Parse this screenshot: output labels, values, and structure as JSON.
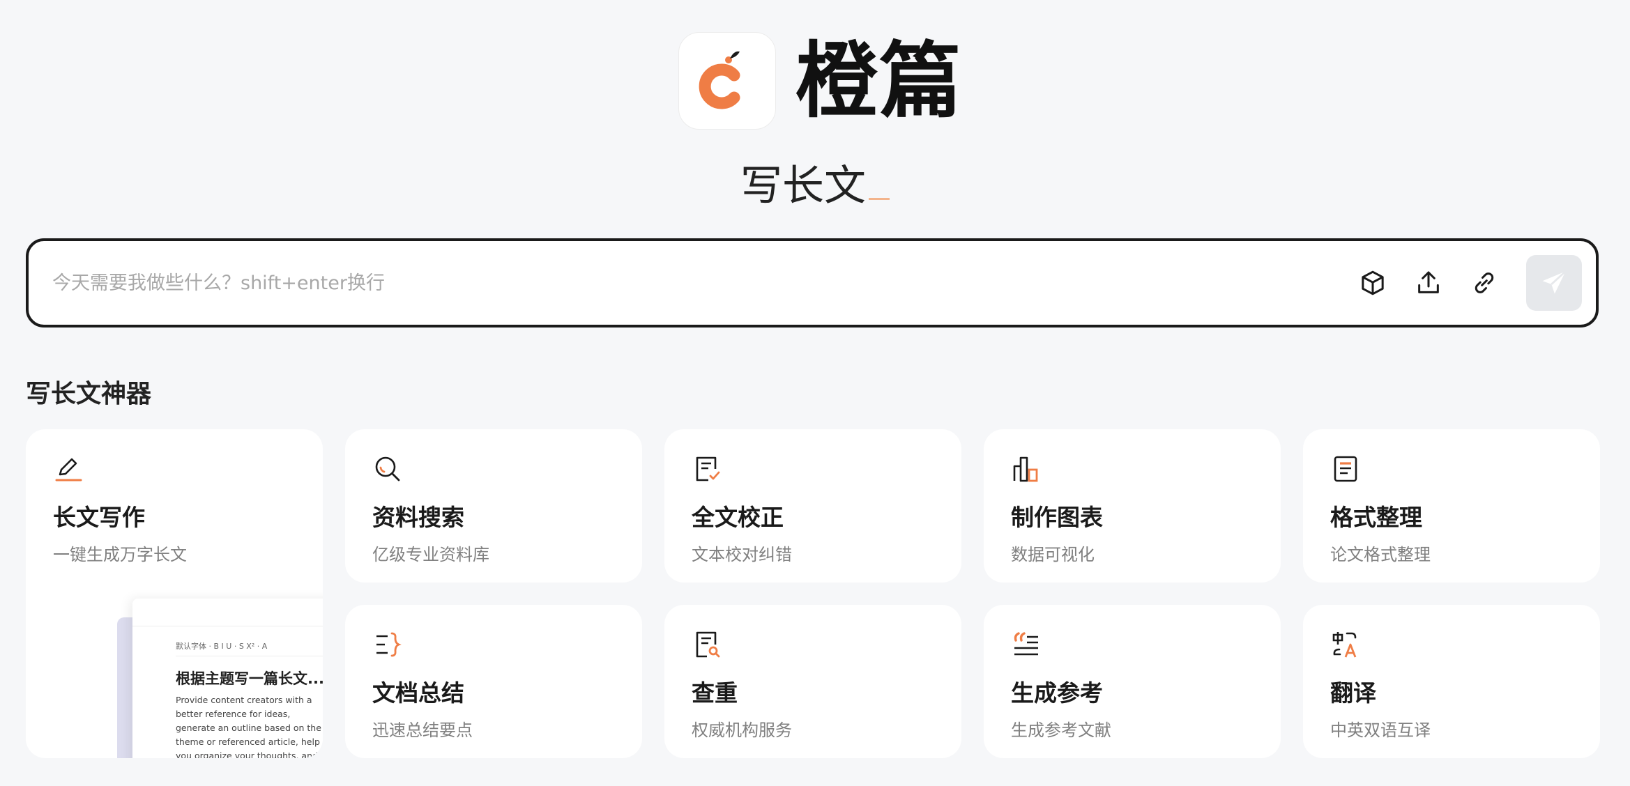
{
  "brand": {
    "name": "橙篇",
    "tagline": "写长文"
  },
  "input": {
    "placeholder": "今天需要我做些什么？shift+enter换行"
  },
  "toolbar": [
    "cube-icon",
    "upload-icon",
    "link-icon",
    "send-icon"
  ],
  "section": {
    "title": "写长文神器"
  },
  "cards": [
    {
      "title": "长文写作",
      "desc": "一键生成万字长文",
      "icon": "pencil-icon"
    },
    {
      "title": "资料搜索",
      "desc": "亿级专业资料库",
      "icon": "search-icon"
    },
    {
      "title": "全文校正",
      "desc": "文本校对纠错",
      "icon": "doc-check-icon"
    },
    {
      "title": "制作图表",
      "desc": "数据可视化",
      "icon": "chart-icon"
    },
    {
      "title": "格式整理",
      "desc": "论文格式整理",
      "icon": "doc-format-icon"
    },
    {
      "title": "文档总结",
      "desc": "迅速总结要点",
      "icon": "summary-icon"
    },
    {
      "title": "查重",
      "desc": "权威机构服务",
      "icon": "doc-search-icon"
    },
    {
      "title": "生成参考",
      "desc": "生成参考文献",
      "icon": "quote-icon"
    },
    {
      "title": "翻译",
      "desc": "中英双语互译",
      "icon": "translate-icon"
    }
  ],
  "preview": {
    "toolbar": "默认字体 ·  B   I   U ·  S  X² ·  A",
    "title": "根据主题写一篇长文...",
    "body": "Provide content creators with a better reference for ideas, generate an outline based on the theme or referenced article, help you organize your thoughts, and generate a ..."
  },
  "colors": {
    "accent": "#ef7d45",
    "text": "#1a1a1a",
    "muted": "#808080",
    "background": "#f6f7f9"
  }
}
